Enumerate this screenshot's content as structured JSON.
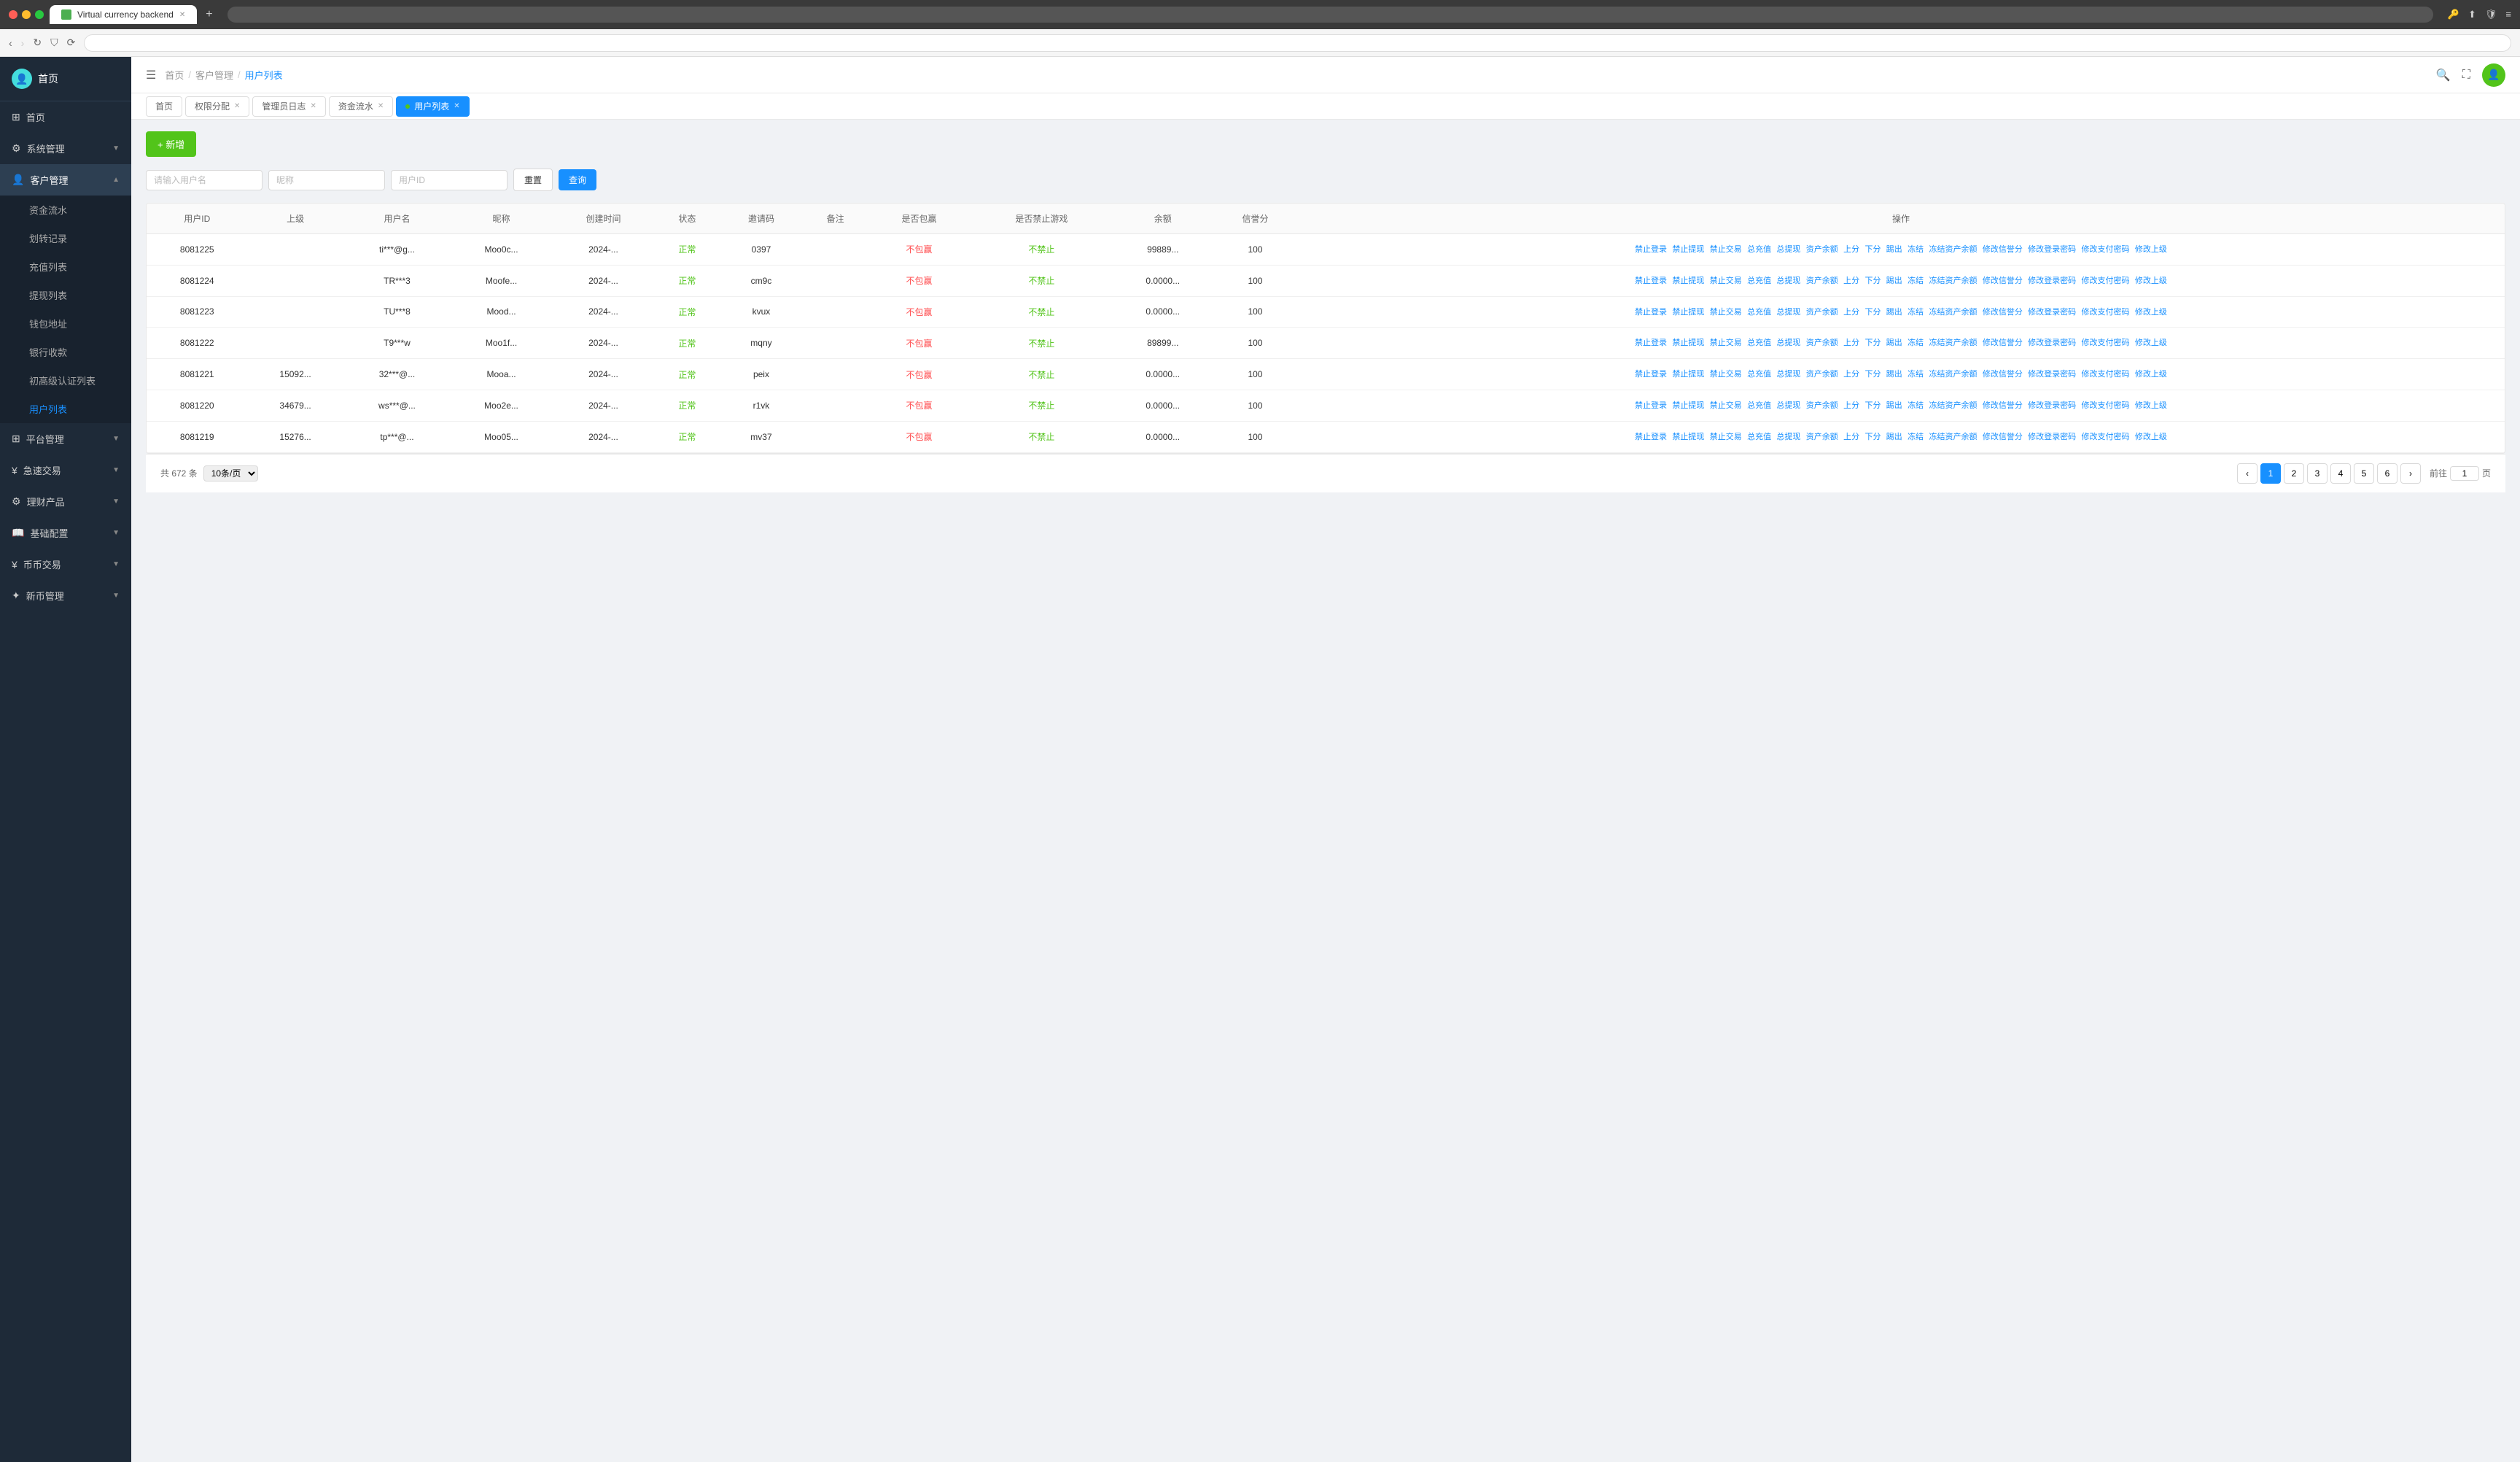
{
  "browser": {
    "tab_title": "Virtual currency backend",
    "tab_favicon": "🌐"
  },
  "header": {
    "menu_icon": "☰",
    "breadcrumbs": [
      "首页",
      "客户管理",
      "用户列表"
    ],
    "search_icon": "🔍",
    "fullscreen_icon": "⛶"
  },
  "tabs": [
    {
      "label": "首页",
      "closable": false,
      "active": false
    },
    {
      "label": "权限分配",
      "closable": true,
      "active": false
    },
    {
      "label": "管理员日志",
      "closable": true,
      "active": false
    },
    {
      "label": "资金流水",
      "closable": true,
      "active": false
    },
    {
      "label": "用户列表",
      "closable": true,
      "active": true,
      "dot": true
    }
  ],
  "sidebar": {
    "logo_text": "首页",
    "items": [
      {
        "id": "home",
        "icon": "⊞",
        "label": "首页",
        "expandable": false,
        "active": false
      },
      {
        "id": "system",
        "icon": "⚙",
        "label": "系统管理",
        "expandable": true,
        "active": false
      },
      {
        "id": "customer",
        "icon": "👤",
        "label": "客户管理",
        "expandable": true,
        "active": true,
        "children": [
          {
            "id": "funds",
            "label": "资金流水",
            "active": false
          },
          {
            "id": "transfer",
            "label": "划转记录",
            "active": false
          },
          {
            "id": "recharge",
            "label": "充值列表",
            "active": false
          },
          {
            "id": "withdraw",
            "label": "提现列表",
            "active": false
          },
          {
            "id": "wallet",
            "label": "钱包地址",
            "active": false
          },
          {
            "id": "bank",
            "label": "银行收款",
            "active": false
          },
          {
            "id": "kyc",
            "label": "初高级认证列表",
            "active": false
          },
          {
            "id": "users",
            "label": "用户列表",
            "active": true
          }
        ]
      },
      {
        "id": "platform",
        "icon": "⊞",
        "label": "平台管理",
        "expandable": true,
        "active": false
      },
      {
        "id": "quick",
        "icon": "¥",
        "label": "急速交易",
        "expandable": true,
        "active": false
      },
      {
        "id": "finance",
        "icon": "⚙",
        "label": "理财产品",
        "expandable": true,
        "active": false
      },
      {
        "id": "base",
        "icon": "📖",
        "label": "基础配置",
        "expandable": true,
        "active": false
      },
      {
        "id": "coin",
        "icon": "¥",
        "label": "币币交易",
        "expandable": true,
        "active": false
      },
      {
        "id": "new_coin",
        "icon": "✦",
        "label": "新币管理",
        "expandable": true,
        "active": false
      }
    ]
  },
  "page": {
    "add_btn": "+ 新增",
    "search": {
      "username_placeholder": "请输入用户名",
      "nickname_placeholder": "昵称",
      "userid_placeholder": "用户ID",
      "reset_btn": "重置",
      "query_btn": "查询"
    },
    "table": {
      "columns": [
        "用户ID",
        "上级",
        "用户名",
        "昵称",
        "创建时间",
        "状态",
        "邀请码",
        "备注",
        "是否包赢",
        "是否禁止游戏",
        "余额",
        "信誉分",
        "操作"
      ],
      "rows": [
        {
          "user_id": "8081225",
          "parent": "",
          "username": "ti***@g...",
          "nickname": "Moo0c...",
          "created": "2024-...",
          "status": "正常",
          "invite": "0397",
          "remark": "",
          "is_win": "不包赢",
          "is_ban": "不禁止",
          "balance": "99889...",
          "credit": "100",
          "actions": [
            "禁止登录",
            "禁止提现",
            "禁止交易",
            "总充值",
            "总提现",
            "资产余额",
            "上分",
            "下分",
            "踢出",
            "冻结",
            "冻结资产余额",
            "修改信誉分",
            "修改登录密码",
            "修改支付密码",
            "修改上级"
          ]
        },
        {
          "user_id": "8081224",
          "parent": "",
          "username": "TR***3",
          "nickname": "Moofe...",
          "created": "2024-...",
          "status": "正常",
          "invite": "cm9c",
          "remark": "",
          "is_win": "不包赢",
          "is_ban": "不禁止",
          "balance": "0.0000...",
          "credit": "100",
          "actions": [
            "禁止登录",
            "禁止提现",
            "禁止交易",
            "总充值",
            "总提现",
            "资产余额",
            "上分",
            "下分",
            "踢出",
            "冻结",
            "冻结资产余额",
            "修改信誉分",
            "修改登录密码",
            "修改支付密码",
            "修改上级"
          ]
        },
        {
          "user_id": "8081223",
          "parent": "",
          "username": "TU***8",
          "nickname": "Mood...",
          "created": "2024-...",
          "status": "正常",
          "invite": "kvux",
          "remark": "",
          "is_win": "不包赢",
          "is_ban": "不禁止",
          "balance": "0.0000...",
          "credit": "100",
          "actions": [
            "禁止登录",
            "禁止提现",
            "禁止交易",
            "总充值",
            "总提现",
            "资产余额",
            "上分",
            "下分",
            "踢出",
            "冻结",
            "冻结资产余额",
            "修改信誉分",
            "修改登录密码",
            "修改支付密码",
            "修改上级"
          ]
        },
        {
          "user_id": "8081222",
          "parent": "",
          "username": "T9***w",
          "nickname": "Moo1f...",
          "created": "2024-...",
          "status": "正常",
          "invite": "mqny",
          "remark": "",
          "is_win": "不包赢",
          "is_ban": "不禁止",
          "balance": "89899...",
          "credit": "100",
          "actions": [
            "禁止登录",
            "禁止提现",
            "禁止交易",
            "总充值",
            "总提现",
            "资产余额",
            "上分",
            "下分",
            "踢出",
            "冻结",
            "冻结资产余额",
            "修改信誉分",
            "修改登录密码",
            "修改支付密码",
            "修改上级"
          ]
        },
        {
          "user_id": "8081221",
          "parent": "15092...",
          "username": "32***@...",
          "nickname": "Mooa...",
          "created": "2024-...",
          "status": "正常",
          "invite": "peix",
          "remark": "",
          "is_win": "不包赢",
          "is_ban": "不禁止",
          "balance": "0.0000...",
          "credit": "100",
          "actions": [
            "禁止登录",
            "禁止提现",
            "禁止交易",
            "总充值",
            "总提现",
            "资产余额",
            "上分",
            "下分",
            "踢出",
            "冻结",
            "冻结资产余额",
            "修改信誉分",
            "修改登录密码",
            "修改支付密码",
            "修改上级"
          ]
        },
        {
          "user_id": "8081220",
          "parent": "34679...",
          "username": "ws***@...",
          "nickname": "Moo2e...",
          "created": "2024-...",
          "status": "正常",
          "invite": "r1vk",
          "remark": "",
          "is_win": "不包赢",
          "is_ban": "不禁止",
          "balance": "0.0000...",
          "credit": "100",
          "actions": [
            "禁止登录",
            "禁止提现",
            "禁止交易",
            "总充值",
            "总提现",
            "资产余额",
            "上分",
            "下分",
            "踢出",
            "冻结",
            "冻结资产余额",
            "修改信誉分",
            "修改登录密码",
            "修改支付密码",
            "修改上级"
          ]
        },
        {
          "user_id": "8081219",
          "parent": "15276...",
          "username": "tp***@...",
          "nickname": "Moo05...",
          "created": "2024-...",
          "status": "正常",
          "invite": "mv37",
          "remark": "",
          "is_win": "不包赢",
          "is_ban": "不禁止",
          "balance": "0.0000...",
          "credit": "100",
          "actions": [
            "禁止登录",
            "禁止提现",
            "禁止交易",
            "总充值",
            "总提现",
            "资产余额",
            "上分",
            "下分",
            "踢出",
            "冻结",
            "冻结资产余额",
            "修改信誉分",
            "修改登录密码",
            "修改支付密码",
            "修改上级"
          ]
        }
      ]
    },
    "pagination": {
      "total": "共 672 条",
      "per_page": "10条/页",
      "pages": [
        "1",
        "2",
        "3",
        "4",
        "5",
        "6"
      ],
      "goto_label": "前往",
      "goto_suffix": "页",
      "current_page": "1"
    }
  }
}
